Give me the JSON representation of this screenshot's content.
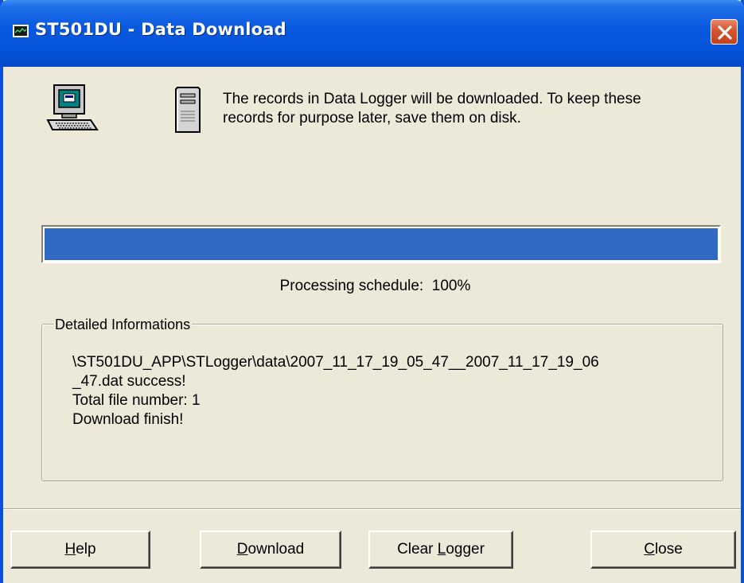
{
  "window": {
    "title": "ST501DU - Data Download",
    "title_icon": "monitor-app-icon",
    "close_icon": "close-icon"
  },
  "header": {
    "computer_icon": "computer-icon",
    "server_icon": "server-tower-icon",
    "message": "The records in Data Logger will be downloaded. To keep these\nrecords for purpose later, save them on disk."
  },
  "progress": {
    "value_percent": 100,
    "fill_color": "#316ac5",
    "label": "Processing schedule:",
    "value_text": "100%"
  },
  "details": {
    "legend": "Detailed Informations",
    "lines": [
      "\\ST501DU_APP\\STLogger\\data\\2007_11_17_19_05_47__2007_11_17_19_06",
      "_47.dat success!",
      "Total file number: 1",
      "Download finish!"
    ]
  },
  "buttons": {
    "help": {
      "access_key": "H",
      "rest": "elp"
    },
    "download": {
      "access_key": "D",
      "rest": "ownload"
    },
    "clear_logger": {
      "prefix": "Clear ",
      "access_key": "L",
      "rest": "ogger"
    },
    "close": {
      "access_key": "C",
      "rest": "lose"
    }
  },
  "colors": {
    "titlebar": "#0553d9",
    "window_face": "#ece9d8",
    "close_button": "#d5542f"
  }
}
